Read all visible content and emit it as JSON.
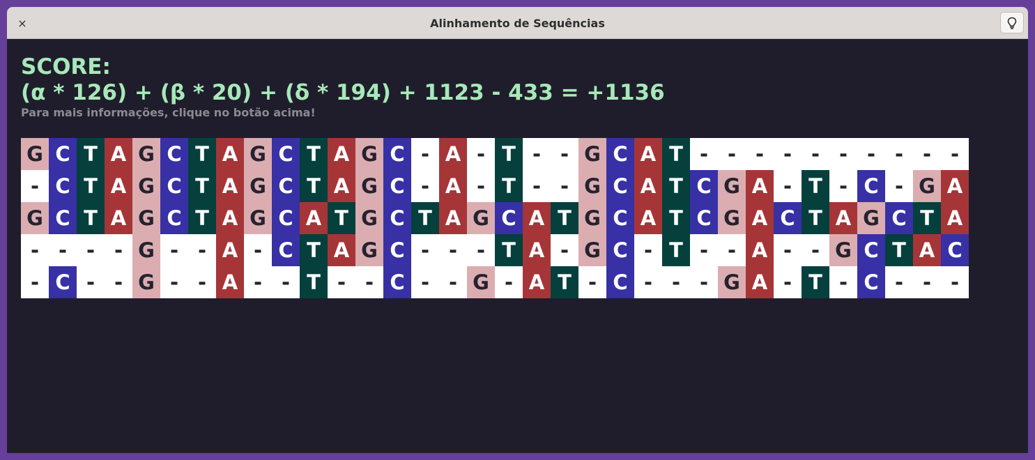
{
  "window": {
    "title": "Alinhamento de Sequências",
    "close_icon": "×"
  },
  "toolbar": {
    "hint_icon": "lightbulb-icon"
  },
  "score": {
    "label": "SCORE:",
    "formula": "(α * 126) + (β * 20) + (δ * 194) + 1123 - 433 = +1136",
    "info": "Para mais informações, clique no botão acima!"
  },
  "colors": {
    "G": "#dbadb1",
    "C": "#3830a5",
    "T": "#05403d",
    "A": "#a63538",
    "gap": "#ffffff",
    "score_text": "#a7e8b8",
    "background": "#1f1d2b"
  },
  "alignment": {
    "rows": [
      "GCTAGCTAGCTAGC-A-T--GCAT----------",
      "-CTAGCTAGCTAGC-A-T--GCATCGA-T-C-GA",
      "GCTAGCTAGCATGCTAGCATGCATCGACTAGCTA",
      "----G--A-CTAGC---TA-GC-T--A--GCTAC",
      "-C--G--A--T--C--G-AT-C---GA-T-C---"
    ]
  }
}
